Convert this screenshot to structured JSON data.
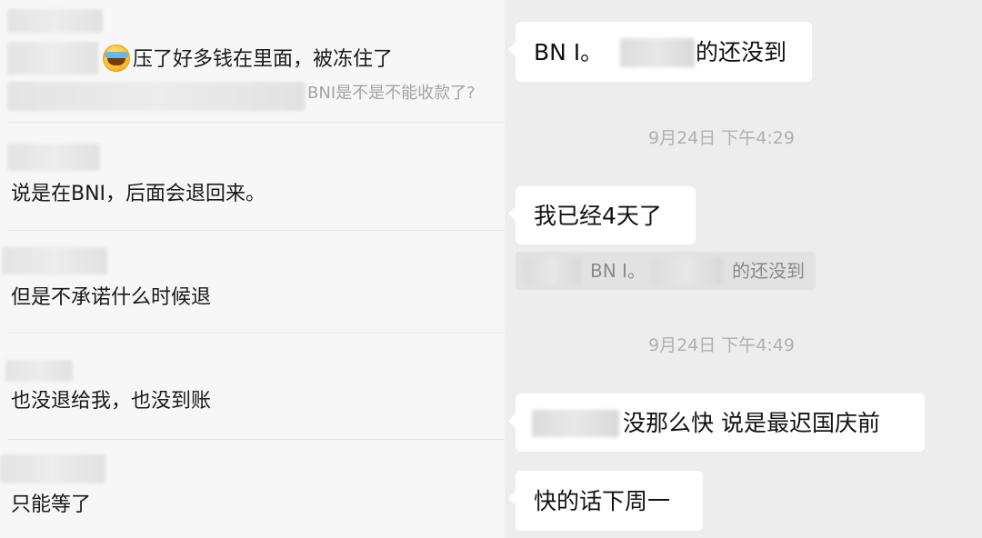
{
  "left_panel": {
    "messages": [
      {
        "text": "压了好多钱在里面，被冻住了",
        "quote": "BNI是不是不能收款了?"
      },
      {
        "text": "说是在BNI，后面会退回来。"
      },
      {
        "text": "但是不承诺什么时候退"
      },
      {
        "text": "也没退给我，也没到账"
      },
      {
        "text": "只能等了"
      }
    ]
  },
  "right_panel": {
    "bubble1": {
      "prefix": "BN I。",
      "suffix": "的还没到"
    },
    "timestamp1": "9月24日 下午4:29",
    "bubble2": {
      "text": "我已经4天了"
    },
    "quote_block": {
      "prefix": "BN I。",
      "suffix": "的还没到"
    },
    "timestamp2": "9月24日 下午4:49",
    "bubble3": {
      "text": "没那么快 说是最迟国庆前"
    },
    "bubble4": {
      "text": "快的话下周一"
    }
  }
}
